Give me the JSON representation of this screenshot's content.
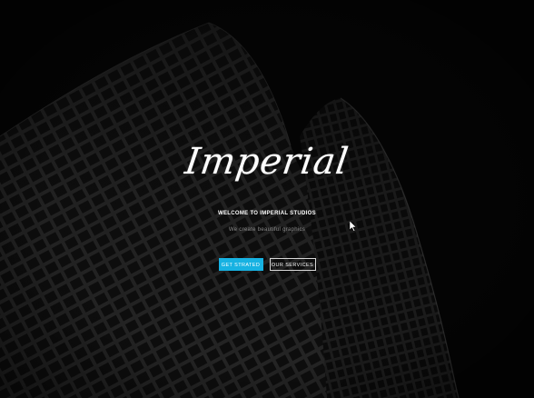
{
  "hero": {
    "logo": "Imperial",
    "welcome": "WELCOME TO IMPERIAL STUDIOS",
    "tagline": "We create beautiful graphics",
    "buttons": {
      "primary_label": "GET STRATED",
      "secondary_label": "OUR SERVICES"
    }
  },
  "colors": {
    "accent": "#17b2e2",
    "background": "#060606",
    "text": "#ffffff",
    "muted_text": "#8a8a8a"
  },
  "icons": {
    "cursor": "mouse-cursor-icon"
  }
}
